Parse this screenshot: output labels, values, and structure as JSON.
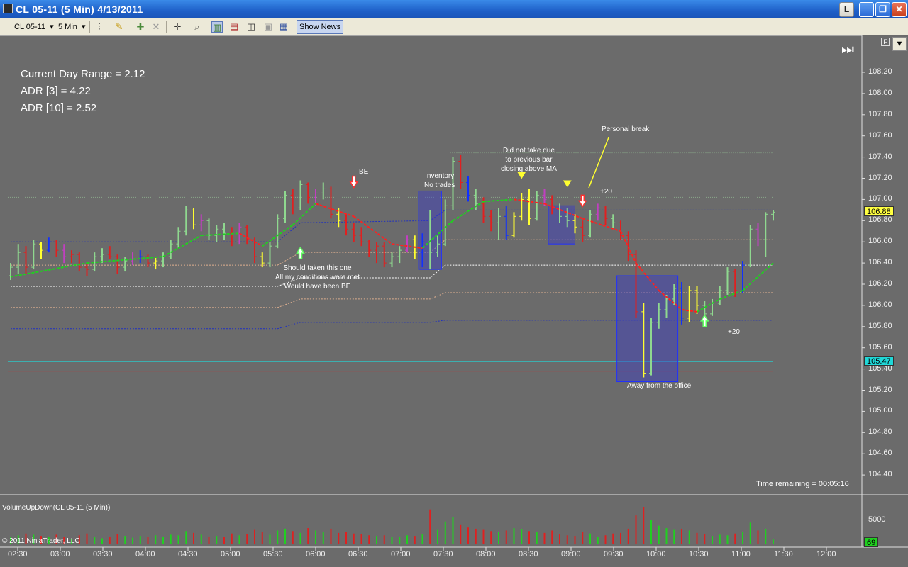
{
  "window": {
    "title": "CL 05-11 (5 Min)  4/13/2011",
    "btn_l": "L",
    "btn_min": "_",
    "btn_max": "❐",
    "btn_close": "✕"
  },
  "toolbar": {
    "instrument": "CL 05-11",
    "interval": "5 Min",
    "show_news": "Show News"
  },
  "chart_labels": {
    "current_day_range": "Current Day Range = 2.12",
    "adr3": "ADR [3] = 4.22",
    "adr10": "ADR [10] = 2.52",
    "be": "BE",
    "inventory": "Inventory\nNo trades",
    "did_not_take": "Did not take due\nto previous bar\nclosing above MA",
    "personal_break": "Personal break",
    "plus20_top": "+20",
    "should_taken": "Should taken this one\nAll my conditions were met\nWould have been BE",
    "away": "Away from the office",
    "plus20_bottom": "+20",
    "time_remaining": "Time remaining = 00:05:16",
    "volume_label": "VolumeUpDown(CL 05-11 (5 Min))",
    "copyright": "© 2011 NinjaTrader, LLC",
    "f_button": "F",
    "last_price": "106.88",
    "cyan_price": "105.47",
    "volume_last": "69",
    "volume_tick": "5000"
  },
  "price_ticks": [
    "108.20",
    "108.00",
    "107.80",
    "107.60",
    "107.40",
    "107.20",
    "107.00",
    "106.80",
    "106.60",
    "106.40",
    "106.20",
    "106.00",
    "105.80",
    "105.60",
    "105.40",
    "105.20",
    "105.00",
    "104.80",
    "104.60",
    "104.40"
  ],
  "time_ticks": [
    "02:30",
    "03:00",
    "03:30",
    "04:00",
    "04:30",
    "05:00",
    "05:30",
    "06:00",
    "06:30",
    "07:00",
    "07:30",
    "08:00",
    "08:30",
    "09:00",
    "09:30",
    "10:00",
    "10:30",
    "11:00",
    "11:30",
    "12:00"
  ],
  "colors": {
    "up_bar": "#8fd88f",
    "down_bar": "#e02020",
    "neutral_bar": "#ffff30",
    "blue_bar": "#1030ff",
    "magenta_bar": "#c040c0",
    "ma_up": "#20d020",
    "ma_down": "#ff2020",
    "cyan_line": "#20d8d8",
    "badge_yellow": "#ffff40",
    "badge_cyan": "#20d8d8",
    "badge_green": "#20d020"
  },
  "chart_data": {
    "type": "candlestick",
    "ylim": [
      104.3,
      108.3
    ],
    "volume_ylim": [
      0,
      8000
    ],
    "bars": [
      [
        0,
        106.28,
        106.4,
        106.24,
        106.36,
        "up",
        1200
      ],
      [
        1,
        106.36,
        106.58,
        106.3,
        106.5,
        "up",
        1500
      ],
      [
        2,
        106.5,
        106.56,
        106.3,
        106.36,
        "down",
        1800
      ],
      [
        3,
        106.36,
        106.62,
        106.34,
        106.58,
        "up",
        1600
      ],
      [
        4,
        106.58,
        106.6,
        106.44,
        106.52,
        "neutral",
        1400
      ],
      [
        5,
        106.52,
        106.64,
        106.5,
        106.6,
        "blue",
        1300
      ],
      [
        6,
        106.6,
        106.62,
        106.46,
        106.52,
        "down",
        1600
      ],
      [
        7,
        106.52,
        106.58,
        106.4,
        106.46,
        "magenta",
        1200
      ],
      [
        8,
        106.46,
        106.52,
        106.4,
        106.48,
        "down",
        900
      ],
      [
        9,
        106.48,
        106.5,
        106.32,
        106.36,
        "down",
        1500
      ],
      [
        10,
        106.36,
        106.4,
        106.28,
        106.34,
        "down",
        1800
      ],
      [
        11,
        106.34,
        106.5,
        106.32,
        106.46,
        "up",
        1200
      ],
      [
        12,
        106.46,
        106.54,
        106.4,
        106.48,
        "up",
        1000
      ],
      [
        13,
        106.48,
        106.56,
        106.44,
        106.46,
        "down",
        1300
      ],
      [
        14,
        106.46,
        106.48,
        106.3,
        106.36,
        "down",
        1700
      ],
      [
        15,
        106.36,
        106.46,
        106.32,
        106.42,
        "up",
        1400
      ],
      [
        16,
        106.42,
        106.5,
        106.38,
        106.44,
        "magenta",
        1100
      ],
      [
        17,
        106.44,
        106.52,
        106.4,
        106.46,
        "blue",
        1400
      ],
      [
        18,
        106.46,
        106.48,
        106.36,
        106.4,
        "down",
        1200
      ],
      [
        19,
        106.4,
        106.46,
        106.34,
        106.42,
        "neutral",
        1500
      ],
      [
        20,
        106.42,
        106.5,
        106.36,
        106.46,
        "up",
        1300
      ],
      [
        21,
        106.46,
        106.62,
        106.44,
        106.58,
        "up",
        1600
      ],
      [
        22,
        106.58,
        106.74,
        106.54,
        106.7,
        "up",
        1500
      ],
      [
        23,
        106.7,
        106.94,
        106.66,
        106.9,
        "up",
        2200
      ],
      [
        24,
        106.9,
        106.92,
        106.72,
        106.76,
        "neutral",
        1900
      ],
      [
        25,
        106.76,
        106.86,
        106.7,
        106.8,
        "magenta",
        1600
      ],
      [
        26,
        106.8,
        106.82,
        106.62,
        106.66,
        "up",
        1300
      ],
      [
        27,
        106.66,
        106.76,
        106.6,
        106.72,
        "up",
        1400
      ],
      [
        28,
        106.72,
        106.78,
        106.62,
        106.68,
        "up",
        1200
      ],
      [
        29,
        106.68,
        106.74,
        106.56,
        106.6,
        "down",
        1800
      ],
      [
        30,
        106.6,
        106.78,
        106.58,
        106.74,
        "magenta",
        1500
      ],
      [
        31,
        106.74,
        106.76,
        106.58,
        106.62,
        "down",
        1700
      ],
      [
        32,
        106.62,
        106.64,
        106.4,
        106.46,
        "down",
        2400
      ],
      [
        33,
        106.46,
        106.5,
        106.36,
        106.4,
        "neutral",
        2100
      ],
      [
        34,
        106.4,
        106.6,
        106.36,
        106.56,
        "up",
        1600
      ],
      [
        35,
        106.56,
        106.86,
        106.54,
        106.82,
        "up",
        2300
      ],
      [
        36,
        106.82,
        107.08,
        106.78,
        107.04,
        "up",
        2600
      ],
      [
        37,
        107.04,
        107.1,
        106.86,
        106.92,
        "down",
        2200
      ],
      [
        38,
        106.92,
        107.18,
        106.9,
        107.14,
        "up",
        1900
      ],
      [
        39,
        107.14,
        107.16,
        106.96,
        107.02,
        "down",
        2700
      ],
      [
        40,
        107.02,
        107.1,
        106.94,
        107.06,
        "magenta",
        2300
      ],
      [
        41,
        107.06,
        107.16,
        107.0,
        107.1,
        "up",
        2000
      ],
      [
        42,
        107.1,
        107.12,
        106.82,
        106.86,
        "down",
        2600
      ],
      [
        43,
        106.86,
        106.92,
        106.74,
        106.8,
        "neutral",
        1900
      ],
      [
        44,
        106.8,
        106.86,
        106.66,
        106.72,
        "down",
        2100
      ],
      [
        45,
        106.72,
        106.78,
        106.6,
        106.66,
        "down",
        1800
      ],
      [
        46,
        106.66,
        106.74,
        106.56,
        106.6,
        "down",
        1700
      ],
      [
        47,
        106.6,
        106.62,
        106.46,
        106.52,
        "down",
        1500
      ],
      [
        48,
        106.52,
        106.6,
        106.4,
        106.56,
        "down",
        1400
      ],
      [
        49,
        106.56,
        106.6,
        106.36,
        106.4,
        "down",
        1500
      ],
      [
        50,
        106.4,
        106.5,
        106.36,
        106.46,
        "up",
        1300
      ],
      [
        51,
        106.46,
        106.56,
        106.4,
        106.52,
        "up",
        1200
      ],
      [
        52,
        106.52,
        106.66,
        106.5,
        106.62,
        "magenta",
        1500
      ],
      [
        53,
        106.62,
        106.66,
        106.44,
        106.5,
        "neutral",
        1400
      ],
      [
        54,
        106.5,
        106.68,
        106.36,
        106.6,
        "blue",
        1700
      ],
      [
        55,
        106.6,
        106.9,
        106.34,
        106.5,
        "up",
        5800
      ],
      [
        56,
        106.5,
        106.66,
        106.46,
        106.58,
        "up",
        2400
      ],
      [
        57,
        106.58,
        107.0,
        106.56,
        106.94,
        "up",
        3800
      ],
      [
        58,
        106.94,
        107.4,
        106.9,
        107.36,
        "up",
        4500
      ],
      [
        59,
        107.36,
        107.42,
        107.1,
        107.16,
        "down",
        3200
      ],
      [
        60,
        107.16,
        107.22,
        106.98,
        107.04,
        "blue",
        2800
      ],
      [
        61,
        107.04,
        107.1,
        106.9,
        106.96,
        "up",
        2600
      ],
      [
        62,
        106.96,
        107.02,
        106.78,
        106.84,
        "down",
        2400
      ],
      [
        63,
        106.84,
        106.9,
        106.7,
        106.78,
        "down",
        2200
      ],
      [
        64,
        106.78,
        106.92,
        106.62,
        106.84,
        "up",
        2100
      ],
      [
        65,
        106.84,
        106.94,
        106.62,
        106.66,
        "blue",
        2300
      ],
      [
        66,
        106.66,
        106.88,
        106.64,
        106.84,
        "neutral",
        2700
      ],
      [
        67,
        106.84,
        107.06,
        106.8,
        107.0,
        "neutral",
        2500
      ],
      [
        68,
        107.0,
        107.1,
        106.76,
        106.82,
        "neutral",
        2200
      ],
      [
        69,
        106.82,
        107.08,
        106.8,
        107.04,
        "up",
        2000
      ],
      [
        70,
        107.04,
        107.1,
        106.94,
        107.0,
        "magenta",
        1900
      ],
      [
        71,
        107.0,
        107.04,
        106.86,
        106.9,
        "down",
        2300
      ],
      [
        72,
        106.9,
        106.96,
        106.78,
        106.84,
        "up",
        1700
      ],
      [
        73,
        106.84,
        106.92,
        106.74,
        106.8,
        "up",
        1500
      ],
      [
        74,
        106.8,
        106.86,
        106.68,
        106.74,
        "neutral",
        1400
      ],
      [
        75,
        106.74,
        106.8,
        106.6,
        106.66,
        "down",
        2000
      ],
      [
        76,
        106.66,
        106.9,
        106.64,
        106.86,
        "up",
        1800
      ],
      [
        77,
        106.86,
        106.96,
        106.8,
        106.92,
        "magenta",
        1300
      ],
      [
        78,
        106.92,
        106.94,
        106.76,
        106.82,
        "down",
        1500
      ],
      [
        79,
        106.82,
        106.86,
        106.72,
        106.78,
        "up",
        1800
      ],
      [
        80,
        106.78,
        106.8,
        106.62,
        106.66,
        "down",
        1900
      ],
      [
        81,
        106.66,
        106.7,
        106.42,
        106.48,
        "down",
        2600
      ],
      [
        82,
        106.48,
        106.52,
        105.88,
        105.94,
        "down",
        4800
      ],
      [
        83,
        105.94,
        106.02,
        105.32,
        105.36,
        "neutral",
        6200
      ],
      [
        84,
        105.36,
        105.88,
        105.34,
        105.84,
        "up",
        4000
      ],
      [
        85,
        105.84,
        106.02,
        105.78,
        105.96,
        "up",
        3100
      ],
      [
        86,
        105.96,
        106.1,
        105.88,
        106.06,
        "up",
        2700
      ],
      [
        87,
        106.06,
        106.2,
        106.0,
        106.16,
        "up",
        2400
      ],
      [
        88,
        106.16,
        106.22,
        105.82,
        105.88,
        "blue",
        2600
      ],
      [
        89,
        105.88,
        106.18,
        105.84,
        106.14,
        "neutral",
        2300
      ],
      [
        90,
        106.14,
        106.18,
        105.92,
        106.0,
        "neutral",
        1900
      ],
      [
        91,
        106.0,
        106.04,
        105.86,
        105.92,
        "up",
        1700
      ],
      [
        92,
        105.92,
        106.06,
        105.9,
        106.02,
        "up",
        1400
      ],
      [
        93,
        106.02,
        106.18,
        106.0,
        106.14,
        "up",
        1600
      ],
      [
        94,
        106.14,
        106.36,
        106.1,
        106.32,
        "up",
        1500
      ],
      [
        95,
        106.32,
        106.34,
        106.08,
        106.14,
        "down",
        1800
      ],
      [
        96,
        106.14,
        106.42,
        106.12,
        106.38,
        "blue",
        2000
      ],
      [
        97,
        106.38,
        106.76,
        106.36,
        106.72,
        "up",
        3600
      ],
      [
        98,
        106.72,
        106.78,
        106.56,
        106.62,
        "magenta",
        2300
      ],
      [
        99,
        106.62,
        106.88,
        106.46,
        106.86,
        "up",
        2600
      ],
      [
        100,
        106.86,
        106.9,
        106.8,
        106.88,
        "up",
        800
      ]
    ],
    "ma": [
      [
        0,
        106.27
      ],
      [
        10,
        106.4
      ],
      [
        20,
        106.46
      ],
      [
        25,
        106.66
      ],
      [
        30,
        106.68
      ],
      [
        33,
        106.56
      ],
      [
        37,
        106.76
      ],
      [
        40,
        106.96
      ],
      [
        45,
        106.84
      ],
      [
        50,
        106.58
      ],
      [
        54,
        106.54
      ],
      [
        58,
        106.8
      ],
      [
        62,
        106.98
      ],
      [
        66,
        107.0
      ],
      [
        70,
        106.96
      ],
      [
        75,
        106.82
      ],
      [
        80,
        106.7
      ],
      [
        82,
        106.4
      ],
      [
        85,
        106.14
      ],
      [
        88,
        105.96
      ],
      [
        90,
        105.94
      ],
      [
        93,
        106.06
      ],
      [
        96,
        106.14
      ],
      [
        100,
        106.4
      ]
    ],
    "levels": [
      {
        "y": 107.44,
        "color": "#8aa88a",
        "dash": "1,2",
        "x0": 58,
        "x1": 100
      },
      {
        "y": 107.02,
        "color": "#8aa88a",
        "dash": "1,2",
        "x0": 0,
        "x1": 100
      },
      {
        "y": 106.6,
        "color": "#2030c0",
        "dash": "2,2",
        "steps": [
          [
            0,
            106.6
          ],
          [
            35,
            106.6
          ],
          [
            38,
            106.78
          ],
          [
            55,
            106.8
          ],
          [
            57,
            106.9
          ],
          [
            100,
            106.9
          ]
        ]
      },
      {
        "y": 106.38,
        "color": "#e0b090",
        "dash": "2,2",
        "steps": [
          [
            0,
            106.38
          ],
          [
            35,
            106.38
          ],
          [
            38,
            106.5
          ],
          [
            55,
            106.5
          ],
          [
            57,
            106.62
          ],
          [
            100,
            106.62
          ]
        ]
      },
      {
        "y": 106.18,
        "color": "#ffffff",
        "dash": "2,2",
        "steps": [
          [
            0,
            106.18
          ],
          [
            35,
            106.18
          ],
          [
            38,
            106.26
          ],
          [
            55,
            106.26
          ],
          [
            57,
            106.38
          ],
          [
            100,
            106.38
          ]
        ]
      },
      {
        "y": 105.98,
        "color": "#e0b090",
        "dash": "2,2",
        "steps": [
          [
            0,
            105.98
          ],
          [
            35,
            105.98
          ],
          [
            38,
            106.06
          ],
          [
            55,
            106.06
          ],
          [
            57,
            106.12
          ],
          [
            100,
            106.12
          ]
        ]
      },
      {
        "y": 105.78,
        "color": "#2030c0",
        "dash": "2,2",
        "steps": [
          [
            0,
            105.78
          ],
          [
            35,
            105.78
          ],
          [
            38,
            105.84
          ],
          [
            55,
            105.84
          ],
          [
            57,
            105.86
          ],
          [
            100,
            105.86
          ]
        ]
      },
      {
        "y": 105.47,
        "color": "#20d8d8",
        "dash": "",
        "x0": 0,
        "x1": 100
      },
      {
        "y": 105.38,
        "color": "#e02020",
        "dash": "",
        "x0": 0,
        "x1": 100
      }
    ],
    "boxes": [
      {
        "x0": 53.5,
        "x1": 56.5,
        "y0": 106.34,
        "y1": 107.08
      },
      {
        "x0": 70.5,
        "x1": 74,
        "y0": 106.58,
        "y1": 106.94
      },
      {
        "x0": 79.5,
        "x1": 87.5,
        "y0": 105.28,
        "y1": 106.28
      }
    ],
    "markers": [
      {
        "bar": 45,
        "price": 107.14,
        "dir": "down",
        "color": "#ff3030"
      },
      {
        "bar": 38,
        "price": 106.52,
        "dir": "up",
        "color": "#60ff60"
      },
      {
        "bar": 75,
        "price": 106.96,
        "dir": "down",
        "color": "#ff3030"
      },
      {
        "bar": 91,
        "price": 105.88,
        "dir": "up",
        "color": "#60ff60"
      },
      {
        "bar": 67,
        "price": 107.22,
        "dir": "tri",
        "color": "#ffff30"
      },
      {
        "bar": 73,
        "price": 107.14,
        "dir": "tri",
        "color": "#ffff30"
      }
    ]
  }
}
